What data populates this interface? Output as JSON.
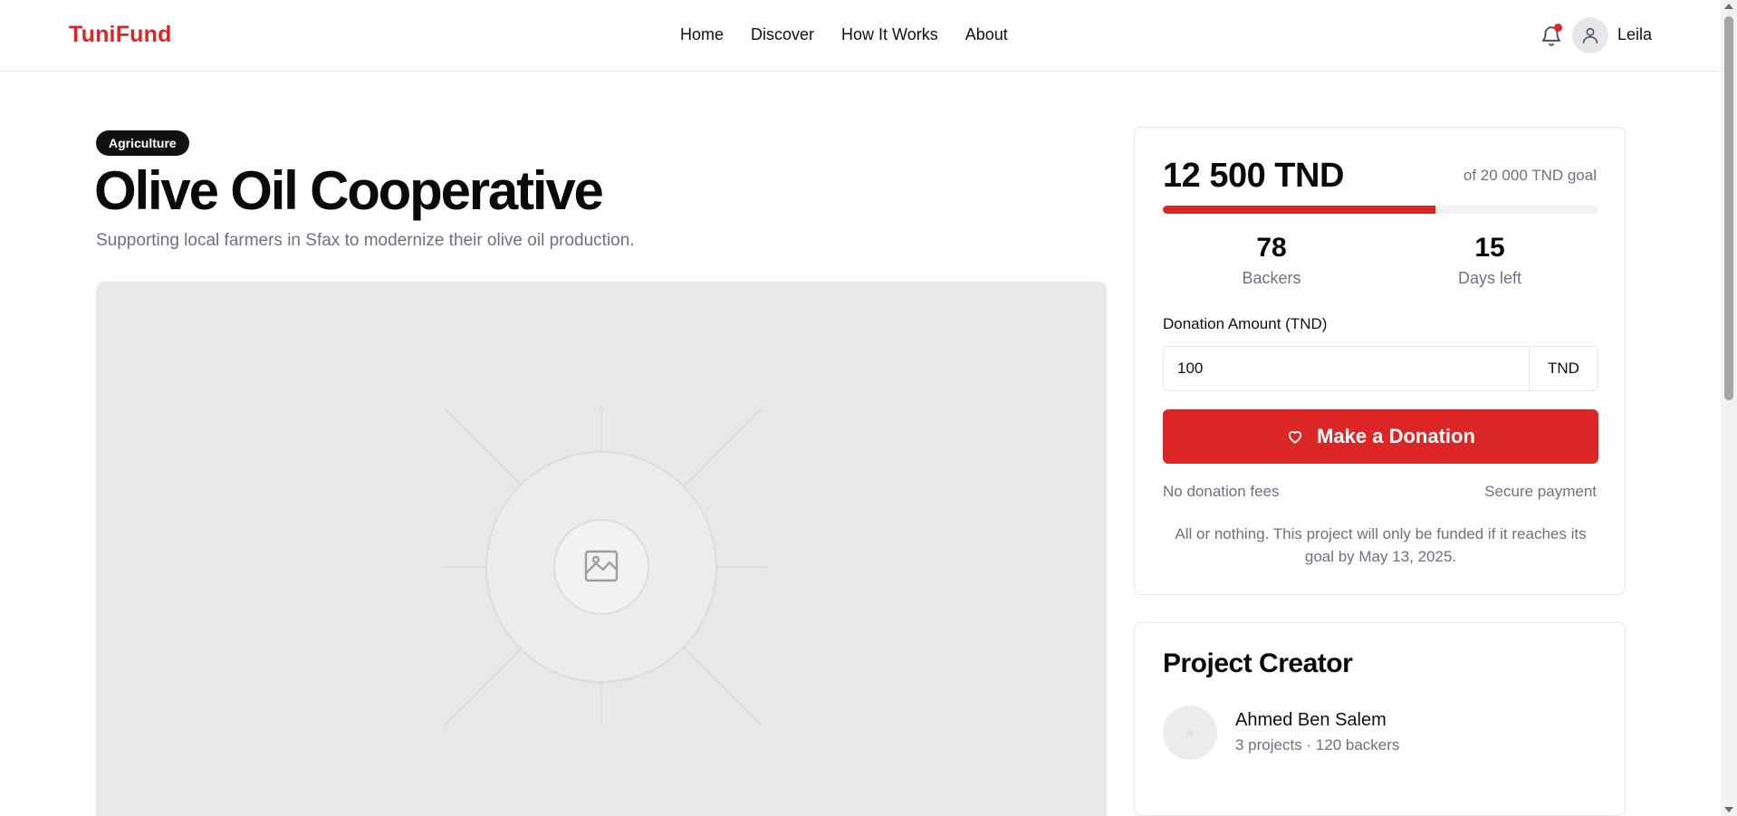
{
  "header": {
    "logo": "TuniFund",
    "nav": [
      "Home",
      "Discover",
      "How It Works",
      "About"
    ],
    "user_name": "Leila"
  },
  "project": {
    "category": "Agriculture",
    "title": "Olive Oil Cooperative",
    "subtitle": "Supporting local farmers in Sfax to modernize their olive oil production."
  },
  "funding": {
    "raised": "12 500 TND",
    "goal_text": "of 20 000 TND goal",
    "progress_fraction": 0.625,
    "backers_count": "78",
    "backers_label": "Backers",
    "days_left": "15",
    "days_label": "Days left",
    "amount_label": "Donation Amount (TND)",
    "amount_value": "100",
    "amount_unit": "TND",
    "donate_label": "Make a Donation",
    "fees_text": "No donation fees",
    "secure_text": "Secure payment",
    "note": "All or nothing. This project will only be funded if it reaches its goal by May 13, 2025."
  },
  "creator": {
    "section_title": "Project Creator",
    "name": "Ahmed Ben Salem",
    "meta": "3 projects · 120 backers"
  },
  "colors": {
    "accent": "#dc2626",
    "muted_text": "#6b7280",
    "badge_bg": "#111111"
  },
  "icons": {
    "notification": "bell-icon",
    "user": "user-icon",
    "donate": "heart-icon",
    "image_placeholder": "image-icon"
  }
}
